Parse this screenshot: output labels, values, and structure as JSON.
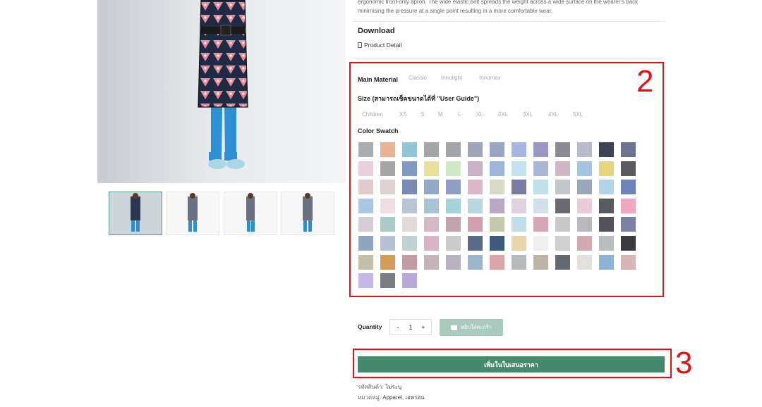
{
  "description": "ergonomic front-only apron. The wide elastic belt spreads the weight across a wide surface on the wearer's back minimising the pressure at a single point resulting in a more comfortable wear.",
  "download": {
    "title": "Download",
    "product_detail": "Product Detail"
  },
  "gallery": {
    "thumb_count": 4,
    "active_index": 0
  },
  "main_material": {
    "label": "Main Material",
    "options": [
      "Classic",
      "Innolight",
      "Innomax"
    ]
  },
  "size": {
    "label": "Size (สามารถเช็คขนาดได้ที่ \"User Guide\")",
    "options": [
      "Children",
      "XS",
      "S",
      "M",
      "L",
      "XL",
      "2XL",
      "3XL",
      "4XL",
      "5XL"
    ]
  },
  "color_swatch": {
    "label": "Color Swatch",
    "swatches": [
      "#a9adb0",
      "#e8b294",
      "#93c4d8",
      "#a4a6a6",
      "#a3a5a7",
      "#a0a6b8",
      "#9aa6c4",
      "#a8b6e2",
      "#9a96c6",
      "#8a8a93",
      "#b9bbcc",
      "#3f4452",
      "#6c7390",
      "#e9d0dc",
      "#a6a6a8",
      "#7f9bc1",
      "#e8e19a",
      "#cfe7c3",
      "#cdb0c8",
      "#9eb5d9",
      "#c3e3ee",
      "#a9b7d5",
      "#cfb8c6",
      "#a3c5e2",
      "#e8d57d",
      "#5a5a60",
      "#e2ccd0",
      "#dfd0d3",
      "#7a8bb3",
      "#91a8c8",
      "#8f9fc4",
      "#e0b7c8",
      "#d8dac8",
      "#7a7ca4",
      "#bfe1ea",
      "#c3c7ca",
      "#9aa8bc",
      "#b4d4ea",
      "#6f84b6",
      "#a9c7e2",
      "#efdde3",
      "#b9c6d2",
      "#a6c4d6",
      "#a4d3d8",
      "#b8d6de",
      "#b9a7c6",
      "#dfd0e2",
      "#d2e1e8",
      "#6a6a75",
      "#e9ccd6",
      "#585a62",
      "#f0a8c0",
      "#d8ccd6",
      "#aacbc8",
      "#e2dad8",
      "#d6b9c6",
      "#c2a3ad",
      "#d19eb2",
      "#c4c9b0",
      "#c3dde8",
      "#d8a8b8",
      "#c6c9c6",
      "#b8b8bd",
      "#53535c",
      "#7b82a5",
      "#8fa6c2",
      "#b6c0d8",
      "#c0d3d2",
      "#d9b4c8",
      "#cbcbcb",
      "#5b6b8c",
      "#3d5b7c",
      "#e8d6a8",
      "#f0eef0",
      "#cfcfd0",
      "#d3a8b0",
      "#babcbd",
      "#3b3b40",
      "#c4c0a8",
      "#d69c5c",
      "#c49aa3",
      "#c4b3b8",
      "#b8b2c0",
      "#9eb6cc",
      "#d8a6a8",
      "#b6bab8",
      "#bbb4a5",
      "#646970",
      "#e3e1dd",
      "#8fb3d2",
      "#d8b6b8",
      "#c6b8e6",
      "#7a7e80",
      "#b8a8d8"
    ]
  },
  "quantity": {
    "label": "Quantity",
    "minus": "-",
    "value": "1",
    "plus": "+"
  },
  "cart_button": "หยิบใส่ตะกร้า",
  "quote_button": "เพิ่มในใบเสนอราคา",
  "meta": {
    "sku_label": "รหัสสินค้า:",
    "sku_value": "ไม่ระบุ",
    "category_label": "หมวดหมู่:",
    "category_value": "Apparel, เอพรอน"
  },
  "annotations": [
    "2",
    "3"
  ],
  "colors": {
    "accent": "#45896f",
    "cart_disabled": "#a9cbbe",
    "annotation": "#e01212"
  }
}
